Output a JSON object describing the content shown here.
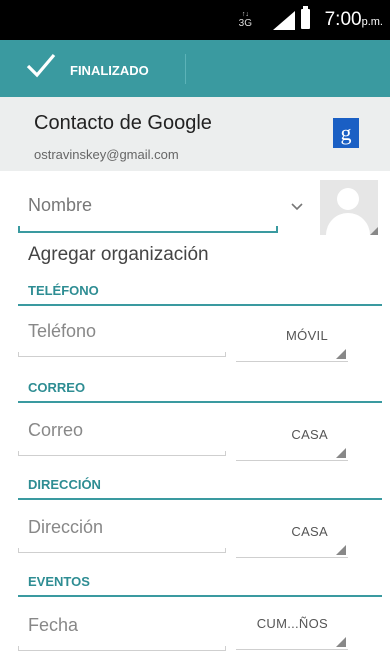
{
  "status_bar": {
    "network": "3G",
    "time": "7:00",
    "ampm": "p.m."
  },
  "action_bar": {
    "done_label": "FINALIZADO"
  },
  "account": {
    "title": "Contacto de Google",
    "email": "ostravinskey@gmail.com",
    "badge": "g"
  },
  "name_field": {
    "placeholder": "Nombre"
  },
  "add_organization": "Agregar organización",
  "sections": {
    "phone": {
      "header": "TELÉFONO",
      "placeholder": "Teléfono",
      "type": "MÓVIL"
    },
    "email": {
      "header": "CORREO",
      "placeholder": "Correo",
      "type": "CASA"
    },
    "address": {
      "header": "DIRECCIÓN",
      "placeholder": "Dirección",
      "type": "CASA"
    },
    "events": {
      "header": "EVENTOS",
      "placeholder": "Fecha",
      "type": "CUM...ÑOS"
    }
  },
  "colors": {
    "accent": "#3a9aa0",
    "status_bar": "#000000",
    "account_bg": "#eceeee",
    "google_badge": "#1a5fc4"
  },
  "icons": [
    "check-icon",
    "signal-icon",
    "battery-icon",
    "chevron-down-icon",
    "contact-photo-icon",
    "google-icon"
  ]
}
